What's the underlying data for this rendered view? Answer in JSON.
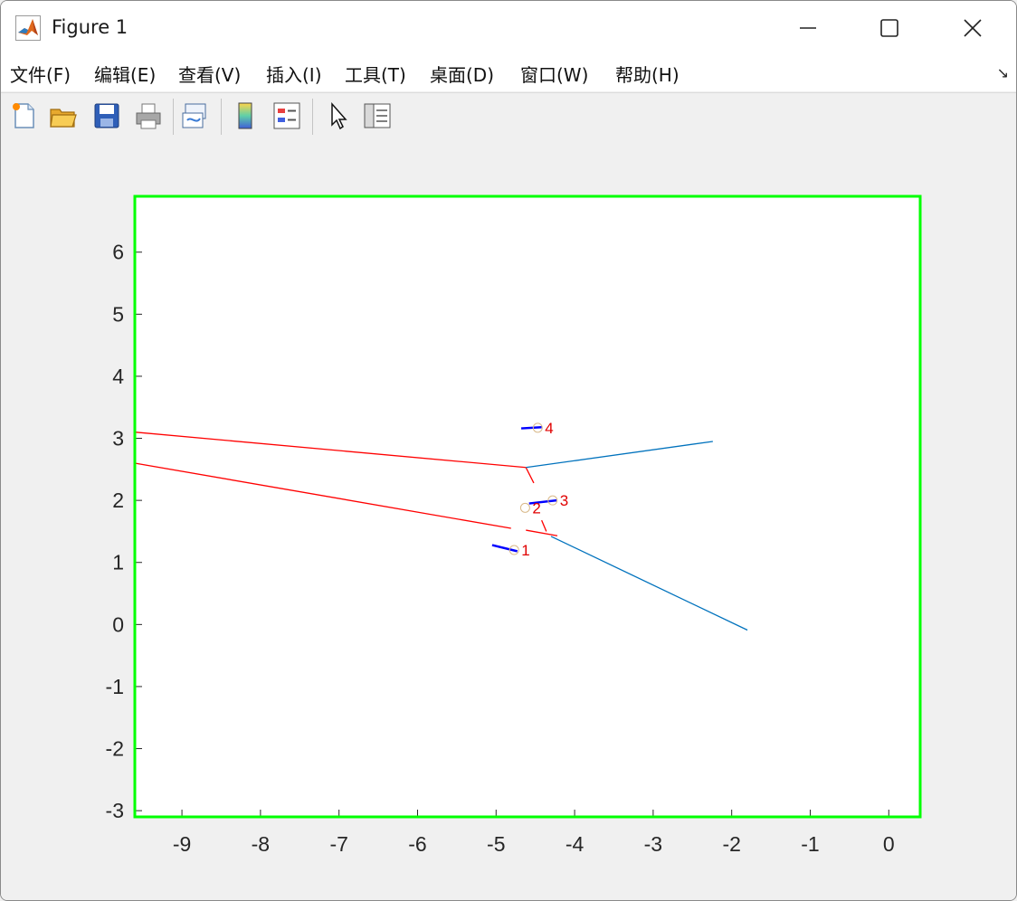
{
  "window": {
    "title": "Figure 1",
    "icon": "matlab-logo-icon",
    "controls": [
      "minimize-icon",
      "maximize-icon",
      "close-icon"
    ]
  },
  "menu": {
    "items": [
      "文件(F)",
      "编辑(E)",
      "查看(V)",
      "插入(I)",
      "工具(T)",
      "桌面(D)",
      "窗口(W)",
      "帮助(H)"
    ],
    "more_icon": "↘"
  },
  "toolbar": {
    "tools": [
      "new-figure-icon",
      "open-file-icon",
      "save-icon",
      "print-icon",
      "link-plot-icon",
      "colorbar-icon",
      "legend-icon",
      "pointer-icon",
      "property-inspector-icon"
    ]
  },
  "colors": {
    "axes_box": "#00ff00",
    "red_lines": "#ff0000",
    "blue_lines": "#0072bd",
    "segments": "#0000ff",
    "labels": "#e00000"
  },
  "chart_data": {
    "type": "line",
    "xlim": [
      -9.6,
      0.4
    ],
    "ylim": [
      -3.1,
      6.9
    ],
    "xticks": [
      -9,
      -8,
      -7,
      -6,
      -5,
      -4,
      -3,
      -2,
      -1,
      0
    ],
    "yticks": [
      -3,
      -2,
      -1,
      0,
      1,
      2,
      3,
      4,
      5,
      6
    ],
    "grid": false,
    "lines": [
      {
        "color": "red",
        "x": [
          -9.6,
          -4.62
        ],
        "y": [
          3.1,
          2.53
        ]
      },
      {
        "color": "red",
        "x": [
          -9.6,
          -4.81
        ],
        "y": [
          2.6,
          1.55
        ]
      },
      {
        "color": "red",
        "x": [
          -4.62,
          -4.52
        ],
        "y": [
          2.53,
          2.28
        ]
      },
      {
        "color": "red",
        "x": [
          -4.42,
          -4.36
        ],
        "y": [
          1.68,
          1.5
        ]
      },
      {
        "color": "red",
        "x": [
          -4.62,
          -4.22
        ],
        "y": [
          1.52,
          1.43
        ]
      },
      {
        "color": "blue",
        "x": [
          -4.62,
          -2.24
        ],
        "y": [
          2.53,
          2.95
        ]
      },
      {
        "color": "blue",
        "x": [
          -4.3,
          -1.8
        ],
        "y": [
          1.42,
          -0.09
        ]
      }
    ],
    "segments": [
      {
        "x": [
          -5.05,
          -4.73
        ],
        "y": [
          1.28,
          1.18
        ]
      },
      {
        "x": [
          -4.58,
          -4.23
        ],
        "y": [
          1.95,
          2.0
        ]
      },
      {
        "x": [
          -4.68,
          -4.42
        ],
        "y": [
          3.16,
          3.18
        ]
      }
    ],
    "points": [
      {
        "label": "1",
        "x": -4.77,
        "y": 1.2
      },
      {
        "label": "2",
        "x": -4.63,
        "y": 1.88
      },
      {
        "label": "3",
        "x": -4.28,
        "y": 2.0
      },
      {
        "label": "4",
        "x": -4.47,
        "y": 3.17
      }
    ]
  }
}
